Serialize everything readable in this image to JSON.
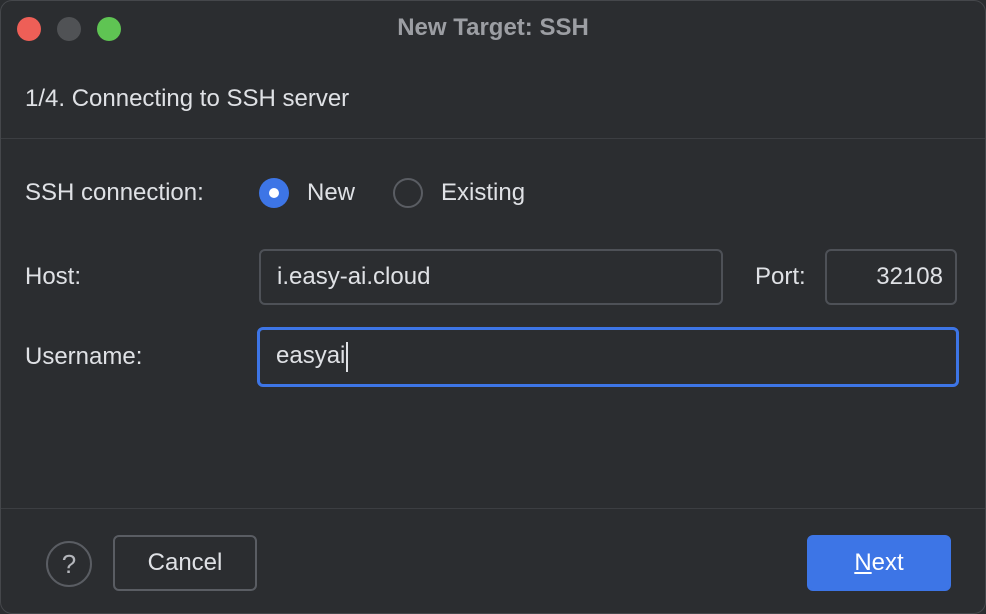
{
  "window": {
    "title": "New Target: SSH"
  },
  "step": {
    "text": "1/4. Connecting to SSH server"
  },
  "connection": {
    "label": "SSH connection:",
    "options": [
      {
        "label": "New",
        "selected": true
      },
      {
        "label": "Existing",
        "selected": false
      }
    ]
  },
  "host": {
    "label": "Host:",
    "value": "i.easy-ai.cloud"
  },
  "port": {
    "label": "Port:",
    "value": "32108"
  },
  "username": {
    "label": "Username:",
    "value": "easyai"
  },
  "footer": {
    "help_label": "?",
    "cancel_label": "Cancel",
    "next_mnemonic": "N",
    "next_rest": "ext"
  },
  "colors": {
    "accent": "#3d75e6",
    "background": "#2b2d30",
    "close": "#ee5f57",
    "minimize": "#505255",
    "maximize": "#5fc453"
  },
  "icons": {
    "help": "question-mark-icon",
    "radio_selected": "radio-selected-icon",
    "radio_unselected": "radio-unselected-icon"
  }
}
